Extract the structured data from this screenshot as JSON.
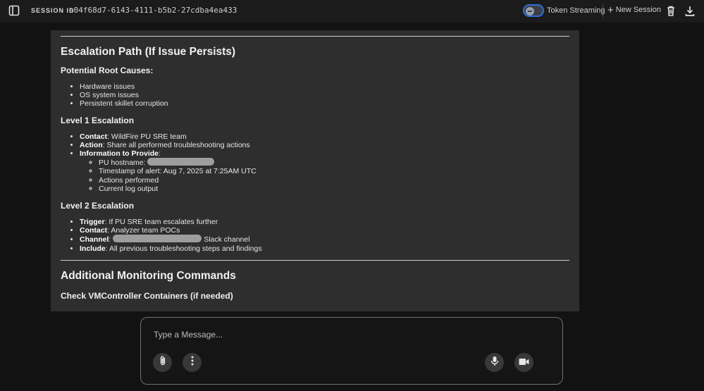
{
  "header": {
    "session_label": "SESSION ID",
    "session_id": "e04f68d7-6143-4111-b5b2-27cdba4ea433",
    "token_streaming_label": "Token Streaming",
    "token_streaming_enabled": false,
    "new_session_label": "New Session",
    "accent_color": "#2f6fd8"
  },
  "content": {
    "escalation_title": "Escalation Path (If Issue Persists)",
    "root_causes_title": "Potential Root Causes:",
    "root_causes": [
      "Hardware issues",
      "OS system issues",
      "Persistent skillet corruption"
    ],
    "level1_title": "Level 1 Escalation",
    "level1": {
      "contact_label": "Contact",
      "contact_value": ": WildFire PU SRE team",
      "action_label": "Action",
      "action_value": ": Share all performed troubleshooting actions",
      "info_label": "Information to Provide",
      "info_suffix": ":",
      "info_items": {
        "hostname": "PU hostname: ",
        "timestamp": "Timestamp of alert: Aug 7, 2025 at 7:25AM UTC",
        "actions": "Actions performed",
        "log": "Current log output"
      }
    },
    "level2_title": "Level 2 Escalation",
    "level2": {
      "trigger_label": "Trigger",
      "trigger_value": ": If PU SRE team escalates further",
      "contact_label": "Contact",
      "contact_value": ": Analyzer team POCs",
      "channel_label": "Channel",
      "channel_value": "Slack channel",
      "include_label": "Include",
      "include_value": ": All previous troubleshooting steps and findings"
    },
    "monitoring_title": "Additional Monitoring Commands",
    "vmcontroller_title": "Check VMController Containers (if needed)"
  },
  "composer": {
    "placeholder": "Type a Message..."
  },
  "icons": {
    "sidebar": "sidebar-toggle-icon",
    "trash": "trash-icon",
    "download": "download-icon",
    "attach": "paperclip-icon",
    "more": "more-vertical-icon",
    "mic": "microphone-icon",
    "video": "video-camera-icon"
  }
}
